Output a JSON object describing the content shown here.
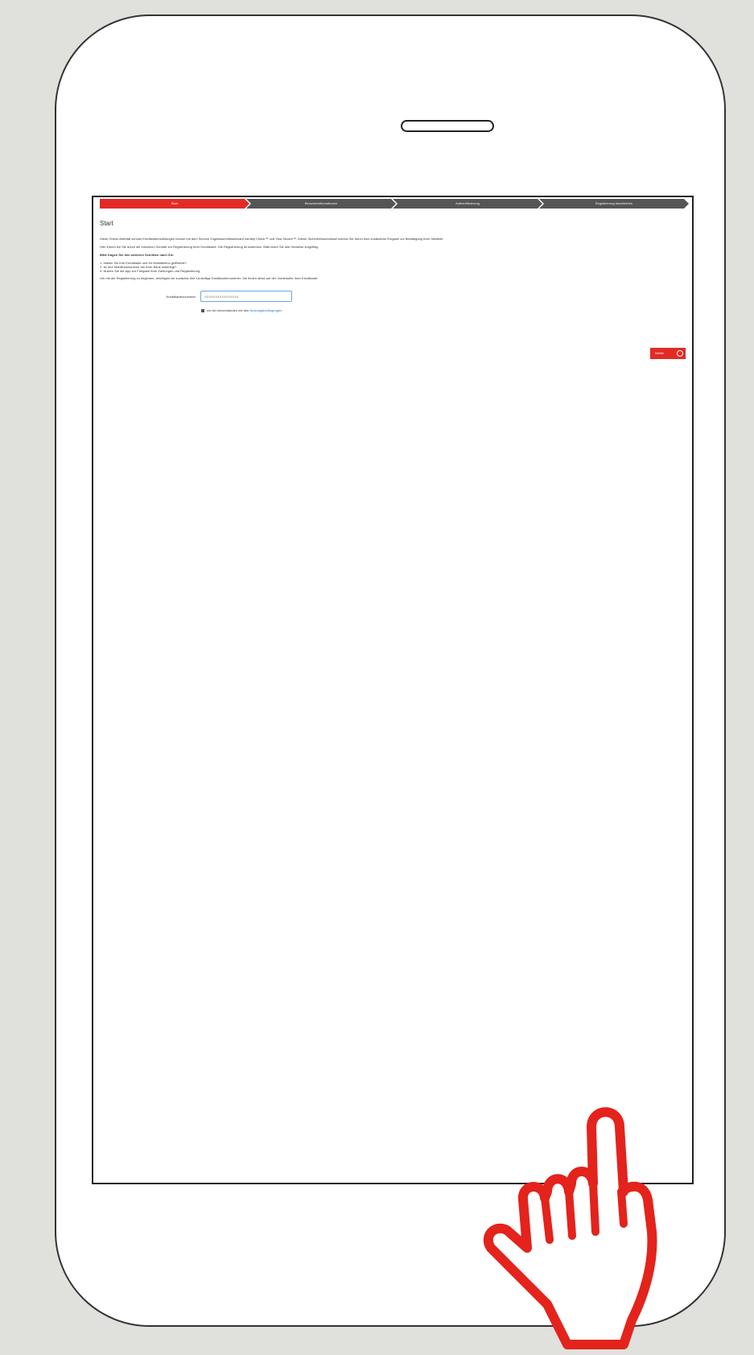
{
  "wizard": {
    "steps": [
      "Start",
      "Benutzerinformationen",
      "Authentifizierung",
      "Registrierung abschließen"
    ]
  },
  "page": {
    "title": "Start",
    "intro_1": "Diese Online-Aktivität schützt Kreditkartenzahlungen besser mit dem Service Zugelassen/Mastercard Identity Check™ und Visa Secure™. Dieser Sicherheitsschlüssel schützt Sie durch eine zusätzliche Eingabe zur Bestätigung Ihrer Identität.",
    "intro_2": "Hier führen wir Sie durch die einzelnen Schritte zur Registrierung Ihrer Kreditkarte. Die Registrierung ist kostenlos. Bitte lesen Sie alle Hinweise sorgfältig.",
    "checklist_title": "Bitte fragen Sie den weiteren Schritten nach Sie:",
    "checklist": [
      "1. Haben Sie Ihre Kreditkarte und Ihr Mobiltelefon griffbereit?",
      "2. Ist Ihre Mobilfunknummer bei Ihrer Bank hinterlegt?",
      "3. Nutzen Sie die App zur Freigabe Ihrer Zahlungen und Registrierung."
    ],
    "intro_3": "Um mit der Registrierung zu beginnen, benötigen wir zunächst Ihre 16-stellige Kreditkartennummer. Sie finden diese auf der Vorderseite Ihrer Kreditkarte.",
    "card_label": "Kreditkartennummer:",
    "card_placeholder": "XXXXXXXXXXXXXXXX",
    "terms_prefix": "Ich bin einverstanden mit den",
    "terms_link": "Nutzungsbedingungen",
    "next_label": "Weiter"
  }
}
